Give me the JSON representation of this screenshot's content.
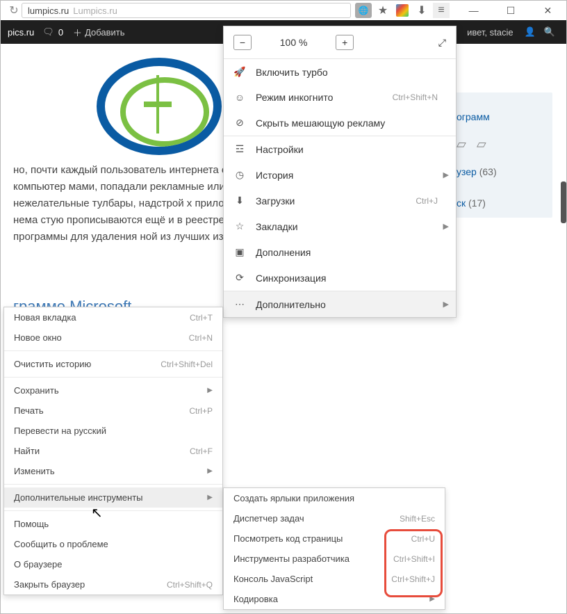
{
  "addrbar": {
    "domain": "lumpics.ru",
    "rest": "Lumpics.ru"
  },
  "sitebar": {
    "site": "pics.ru",
    "comments": "0",
    "add": "Добавить",
    "greet": "ивет, stacie"
  },
  "page": {
    "paragraph": "но, почти каждый пользователь интернета едома, либо по недосмотру, на компьютер мами, попадали рекламные или шпионски ивались нежелательные тулбары, надстрой х приложений может быть связано с нема стую прописываются ещё и в реестре опер ют специальные программы для удаления ной из лучших из них заслуженно считаетс",
    "heading2": "грамме Microsoft"
  },
  "sidebar": {
    "link1": "ограмм",
    "link2": "узер",
    "cnt2": "(63)",
    "link3": "ск",
    "cnt3": "(17)"
  },
  "ymenu": {
    "zoom": "100 %",
    "turbo": "Включить турбо",
    "incognito": "Режим инкогнито",
    "incognito_sc": "Ctrl+Shift+N",
    "hide_ads": "Скрыть мешающую рекламу",
    "settings": "Настройки",
    "history": "История",
    "downloads": "Загрузки",
    "downloads_sc": "Ctrl+J",
    "bookmarks": "Закладки",
    "addons": "Дополнения",
    "sync": "Синхронизация",
    "more": "Дополнительно"
  },
  "cmenu": {
    "new_tab": "Новая вкладка",
    "new_tab_sc": "Ctrl+T",
    "new_window": "Новое окно",
    "new_window_sc": "Ctrl+N",
    "clear_history": "Очистить историю",
    "clear_history_sc": "Ctrl+Shift+Del",
    "save": "Сохранить",
    "print": "Печать",
    "print_sc": "Ctrl+P",
    "translate": "Перевести на русский",
    "find": "Найти",
    "find_sc": "Ctrl+F",
    "edit": "Изменить",
    "more_tools": "Дополнительные инструменты",
    "help": "Помощь",
    "report": "Сообщить о проблеме",
    "about": "О браузере",
    "quit": "Закрыть браузер",
    "quit_sc": "Ctrl+Shift+Q"
  },
  "tmenu": {
    "shortcuts": "Создать ярлыки приложения",
    "task_mgr": "Диспетчер задач",
    "task_mgr_sc": "Shift+Esc",
    "view_source": "Посмотреть код страницы",
    "view_source_sc": "Ctrl+U",
    "devtools": "Инструменты разработчика",
    "devtools_sc": "Ctrl+Shift+I",
    "js_console": "Консоль JavaScript",
    "js_console_sc": "Ctrl+Shift+J",
    "encoding": "Кодировка"
  }
}
